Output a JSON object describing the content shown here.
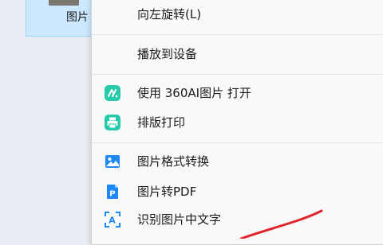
{
  "file": {
    "name": "图片"
  },
  "menu": {
    "items": [
      {
        "label": "向左旋转(L)",
        "icon": null
      },
      {
        "label": "播放到设备",
        "icon": null
      },
      {
        "label": "使用 360AI图片 打开",
        "icon": "360ai-image-app-icon"
      },
      {
        "label": "排版打印",
        "icon": "printer-icon"
      },
      {
        "label": "图片格式转换",
        "icon": "image-convert-icon"
      },
      {
        "label": "图片转PDF",
        "icon": "pdf-p-icon"
      },
      {
        "label": "识别图片中文字",
        "icon": "text-recognition-icon"
      }
    ]
  },
  "colors": {
    "menu_background": "#f9f9f9",
    "selection_background": "#cce8ff",
    "teal_icon": "#26c9a8",
    "blue_icon": "#1e88f5",
    "annotation_red": "#e0242b"
  }
}
